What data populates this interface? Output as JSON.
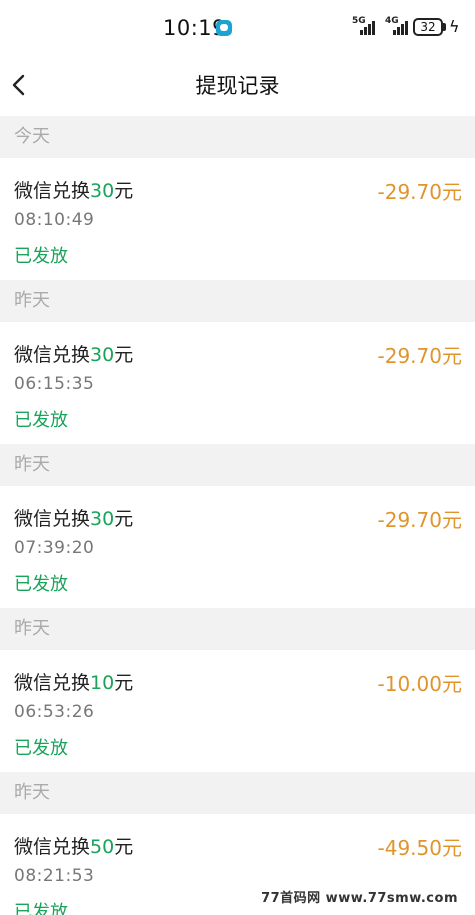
{
  "status_bar": {
    "time": "10:19",
    "network_1": "5G",
    "network_2": "4G",
    "battery": "32"
  },
  "nav": {
    "title": "提现记录"
  },
  "groups": [
    {
      "date": "今天",
      "record": {
        "title_prefix": "微信兑换",
        "title_amount": "30",
        "title_suffix": "元",
        "amount": "-29.70元",
        "time": "08:10:49",
        "status": "已发放"
      }
    },
    {
      "date": "昨天",
      "record": {
        "title_prefix": "微信兑换",
        "title_amount": "30",
        "title_suffix": "元",
        "amount": "-29.70元",
        "time": "06:15:35",
        "status": "已发放"
      }
    },
    {
      "date": "昨天",
      "record": {
        "title_prefix": "微信兑换",
        "title_amount": "30",
        "title_suffix": "元",
        "amount": "-29.70元",
        "time": "07:39:20",
        "status": "已发放"
      }
    },
    {
      "date": "昨天",
      "record": {
        "title_prefix": "微信兑换",
        "title_amount": "10",
        "title_suffix": "元",
        "amount": "-10.00元",
        "time": "06:53:26",
        "status": "已发放"
      }
    },
    {
      "date": "昨天",
      "record": {
        "title_prefix": "微信兑换",
        "title_amount": "50",
        "title_suffix": "元",
        "amount": "-49.50元",
        "time": "08:21:53",
        "status": "已发放"
      }
    }
  ],
  "watermark": "77首码网 www.77smw.com",
  "colors": {
    "green": "#1aa35a",
    "amount_orange": "#e0952c",
    "header_bg": "#f2f2f2"
  }
}
